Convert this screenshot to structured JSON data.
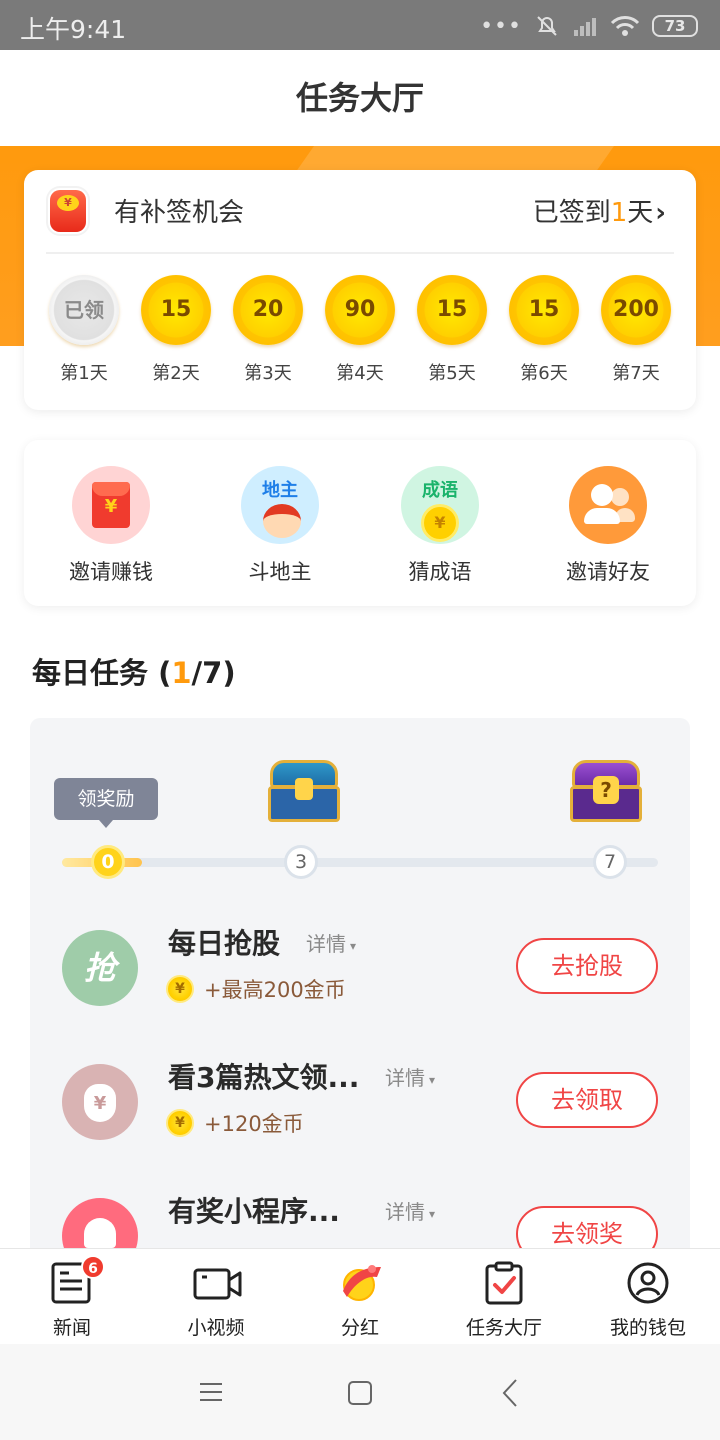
{
  "status_bar": {
    "time": "上午9:41",
    "battery": "73",
    "dots": "•••"
  },
  "header": {
    "title": "任务大厅"
  },
  "signin": {
    "makeup_label": "有补签机会",
    "signed_prefix": "已签到",
    "signed_days": "1",
    "signed_suffix": "天",
    "chevron": "›",
    "days": [
      {
        "value": "已领",
        "label": "第1天",
        "claimed": true
      },
      {
        "value": "15",
        "label": "第2天",
        "claimed": false
      },
      {
        "value": "20",
        "label": "第3天",
        "claimed": false
      },
      {
        "value": "90",
        "label": "第4天",
        "claimed": false
      },
      {
        "value": "15",
        "label": "第5天",
        "claimed": false
      },
      {
        "value": "15",
        "label": "第6天",
        "claimed": false
      },
      {
        "value": "200",
        "label": "第7天",
        "claimed": false
      }
    ]
  },
  "features": [
    {
      "label": "邀请赚钱",
      "icon": "red-envelope-icon",
      "icon_text": "¥"
    },
    {
      "label": "斗地主",
      "icon": "landlord-game-icon",
      "icon_text": "地主"
    },
    {
      "label": "猜成语",
      "icon": "idiom-game-icon",
      "icon_text": "成语",
      "coin_text": "¥"
    },
    {
      "label": "邀请好友",
      "icon": "friends-icon"
    }
  ],
  "daily": {
    "title_prefix": "每日任务 (",
    "done": "1",
    "title_suffix": "/7)",
    "tooltip": "领奖励",
    "progress": {
      "current": 0,
      "max": 7,
      "nodes": [
        "0",
        "3",
        "7"
      ]
    },
    "chest_lock_glyph": "?",
    "tasks": [
      {
        "name": "每日抢股",
        "more": "详情",
        "reward": "+最高200金币",
        "button": "去抢股",
        "avatar_text": "抢"
      },
      {
        "name": "看3篇热文领...",
        "more": "详情",
        "reward": "+120金币",
        "button": "去领取",
        "avatar_text": "¥"
      },
      {
        "name": "有奖小程序...",
        "more": "详情",
        "reward": "",
        "button": "去领奖"
      }
    ],
    "coin_glyph": "¥",
    "dropdown_glyph": "▾"
  },
  "bottom_nav": {
    "items": [
      {
        "label": "新闻",
        "icon": "news-icon",
        "badge": "6"
      },
      {
        "label": "小视频",
        "icon": "video-icon"
      },
      {
        "label": "分红",
        "icon": "dividend-icon"
      },
      {
        "label": "任务大厅",
        "icon": "task-clipboard-icon",
        "active": true
      },
      {
        "label": "我的钱包",
        "icon": "wallet-user-icon"
      }
    ]
  },
  "colors": {
    "accent_orange": "#ff9a0d",
    "button_red": "#f04545",
    "coin_yellow": "#ffd000",
    "status_bar": "#7a7a7a"
  }
}
